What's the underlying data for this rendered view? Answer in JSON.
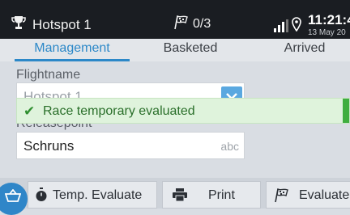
{
  "status_bar": {
    "title": "Hotspot 1",
    "counter": "0/3",
    "time": "11:21:4",
    "date": "13 May 20"
  },
  "tabs": [
    {
      "label": "Management",
      "active": true
    },
    {
      "label": "Basketed",
      "active": false
    },
    {
      "label": "Arrived",
      "active": false
    }
  ],
  "form": {
    "flightname_label": "Flightname",
    "flightname_value": "Hotspot 1",
    "releasepoint_label": "Releasepoint",
    "releasepoint_value": "Schruns",
    "releasepoint_suffix": "abc"
  },
  "toast": {
    "message": "Race temporary evaluated"
  },
  "toolbar": {
    "temp_evaluate": "Temp. Evaluate",
    "print": "Print",
    "evaluate": "Evaluate"
  },
  "colors": {
    "accent": "#2c88c8",
    "success": "#3fae3f",
    "status_bar": "#1a1d22"
  },
  "icons": [
    "trophy-icon",
    "flag-icon",
    "signal-icon",
    "location-icon",
    "check-icon",
    "stopwatch-icon",
    "printer-icon",
    "flag-icon",
    "chevron-icon"
  ]
}
